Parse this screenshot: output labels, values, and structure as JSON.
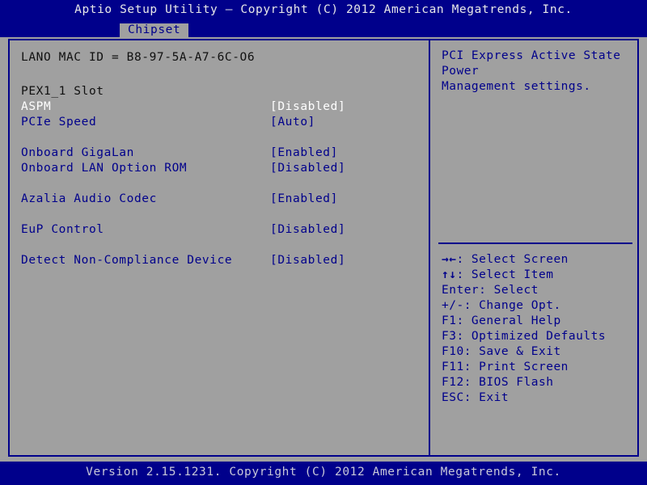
{
  "window": {
    "title": "Aptio Setup Utility – Copyright (C) 2012 American Megatrends, Inc.",
    "footer": "Version 2.15.1231. Copyright (C) 2012 American Megatrends, Inc."
  },
  "tabs": [
    {
      "label": "Chipset",
      "active": true
    }
  ],
  "colors": {
    "title_bar": "#00008b",
    "body_background": "#a0a0a0",
    "item_text": "#00008b",
    "info_text": "#101010",
    "selected_text": "#ffffff",
    "footer_bar": "#00008b"
  },
  "main": {
    "rows": [
      {
        "label": "LANO MAC ID = B8-97-5A-A7-6C-O6",
        "value": "",
        "style": "info",
        "interactable": false
      },
      {
        "label": "PEX1_1 Slot",
        "value": "",
        "style": "info",
        "interactable": false
      },
      {
        "label": "ASPM",
        "value": "[Disabled]",
        "style": "selected",
        "interactable": true
      },
      {
        "label": "PCIe Speed",
        "value": "[Auto]",
        "style": "item",
        "interactable": true
      },
      {
        "label": "Onboard GigaLan",
        "value": "[Enabled]",
        "style": "item",
        "interactable": true
      },
      {
        "label": "Onboard LAN Option ROM",
        "value": "[Disabled]",
        "style": "item",
        "interactable": true
      },
      {
        "label": "Azalia Audio Codec",
        "value": "[Enabled]",
        "style": "item",
        "interactable": true
      },
      {
        "label": "EuP Control",
        "value": "[Disabled]",
        "style": "item",
        "interactable": true
      },
      {
        "label": "Detect Non-Compliance Device",
        "value": "[Disabled]",
        "style": "item",
        "interactable": true
      }
    ]
  },
  "help": {
    "text": "PCI Express Active State Power\nManagement settings."
  },
  "keys": [
    {
      "glyph": "→←",
      "text": ": Select Screen"
    },
    {
      "glyph": "↑↓",
      "text": ": Select Item"
    },
    {
      "glyph": "",
      "text": "Enter: Select"
    },
    {
      "glyph": "",
      "text": "+/-: Change Opt."
    },
    {
      "glyph": "",
      "text": "F1: General Help"
    },
    {
      "glyph": "",
      "text": "F3: Optimized Defaults"
    },
    {
      "glyph": "",
      "text": "F10: Save & Exit"
    },
    {
      "glyph": "",
      "text": "F11: Print Screen"
    },
    {
      "glyph": "",
      "text": "F12: BIOS Flash"
    },
    {
      "glyph": "",
      "text": "ESC: Exit"
    }
  ]
}
